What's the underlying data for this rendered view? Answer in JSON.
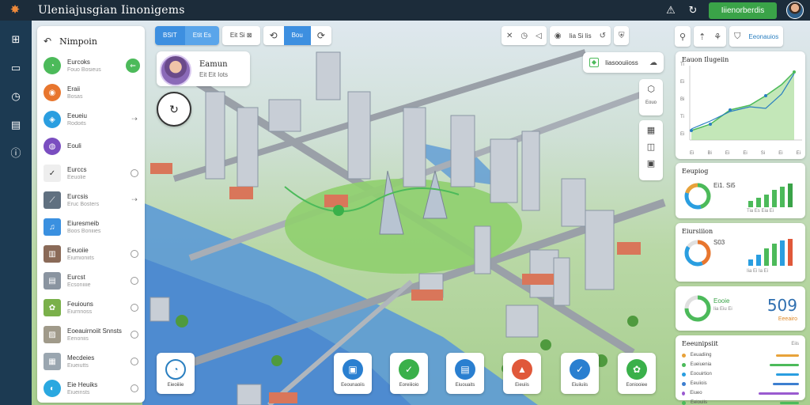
{
  "app": {
    "title": "Uleniajusgian Iinonigems"
  },
  "topbar": {
    "action_label": "Iiienorberdis"
  },
  "left_panel": {
    "title": "Nimpoin",
    "items": [
      {
        "name": "Eurcoks",
        "sub": "Fouo Bosieus",
        "color": "#4cba5a",
        "shape": "circle",
        "action": "green",
        "glyph": "◔"
      },
      {
        "name": "Eraii",
        "sub": "Bosas",
        "color": "#e8762e",
        "shape": "circle",
        "action": "none",
        "glyph": "◉"
      },
      {
        "name": "Eeueiu",
        "sub": "Rodoits",
        "color": "#2a9ee0",
        "shape": "circle",
        "action": "arrow",
        "glyph": "◈"
      },
      {
        "name": "Eouli",
        "sub": "",
        "color": "#7a4ec0",
        "shape": "circle",
        "action": "none",
        "glyph": "◍"
      },
      {
        "name": "Eurccs",
        "sub": "Eeuolie",
        "color": "#eeeeee",
        "shape": "square",
        "action": "ring",
        "glyph": "✓"
      },
      {
        "name": "Eurcsis",
        "sub": "Eruc Bosters",
        "color": "#607080",
        "shape": "square",
        "action": "arrow",
        "glyph": "⟋"
      },
      {
        "name": "Eiuresmeib",
        "sub": "Boos Boniiies",
        "color": "#3a90e0",
        "shape": "square",
        "action": "none",
        "glyph": "♫"
      },
      {
        "name": "Eeuoiie",
        "sub": "Eiumioniits",
        "color": "#8a6a58",
        "shape": "square",
        "action": "ring",
        "glyph": "▥"
      },
      {
        "name": "Eurcst",
        "sub": "Ecsoniiiie",
        "color": "#8a94a0",
        "shape": "square",
        "action": "ring",
        "glyph": "▤"
      },
      {
        "name": "Feuiouns",
        "sub": "Eiurnnoss",
        "color": "#7ab04a",
        "shape": "square",
        "action": "ring",
        "glyph": "✿"
      },
      {
        "name": "Eoeauirnoiit Snnsts",
        "sub": "Eenoniis",
        "color": "#a09a8a",
        "shape": "square",
        "action": "ring",
        "glyph": "▨"
      },
      {
        "name": "Mecdeies",
        "sub": "Eiueiutts",
        "color": "#9aa6b0",
        "shape": "square",
        "action": "ring",
        "glyph": "▦"
      },
      {
        "name": "Eie Heuiks",
        "sub": "Eiueinsts",
        "color": "#2aa8e0",
        "shape": "circle",
        "action": "ring",
        "glyph": "◐"
      }
    ]
  },
  "toolbar": {
    "btn1": "BSIT",
    "btn2": "Etit Es",
    "btn3": "Eit Si ⊠",
    "btn4": "Bou"
  },
  "map_tools": {
    "label": "Iia Si Iis"
  },
  "user_card": {
    "name": "Eamun",
    "sub": "Eit Eit Iots"
  },
  "clock": {
    "glyph": "↻"
  },
  "notify": {
    "label": "Iiasoouiioss"
  },
  "side_tools": {
    "label1": "Eouo"
  },
  "right_tools": {
    "label": "Eeonauios"
  },
  "widget_line": {
    "title": "Eauon Ilugeiin",
    "y_ticks": [
      "Ti",
      "Ei",
      "Bi",
      "Ti",
      "Ei"
    ],
    "x_ticks": [
      "Ei",
      "Bi",
      "Ei",
      "Ei",
      "Si",
      "Ei",
      "Ei"
    ]
  },
  "widget_bars1": {
    "title": "Eeupiog",
    "value": "Ei1. Si5",
    "sub": "Tia Es Eia Ei"
  },
  "widget_bars2": {
    "title": "Eiursiiion",
    "value": "S03",
    "sub": "Iia Ei Ia Ei"
  },
  "widget_kpi": {
    "label": "Eooie",
    "sub": "Iia Eiu Ei",
    "value": "509",
    "value_sub": "Eeeairo"
  },
  "widget_legend": {
    "title": "Eeeunipsiit",
    "tag": "Eiis",
    "rows": [
      {
        "label": "Eeuadiing",
        "color": "#e8a23a"
      },
      {
        "label": "Eueiuenia",
        "color": "#4cba5a"
      },
      {
        "label": "Eoouirtion",
        "color": "#2a9ee0"
      },
      {
        "label": "Eeuiiois",
        "color": "#3d7fd0"
      },
      {
        "label": "Eiueo",
        "color": "#9a5ad0"
      },
      {
        "label": "Eeiouiis",
        "color": "#4cba5a"
      }
    ]
  },
  "dock": [
    {
      "label": "Eieoiiiie",
      "color": "#ffffff",
      "glyph": "◔",
      "border": "#2a7fc0"
    },
    {
      "label": "Eeounaoiis",
      "color": "#2a7fd0",
      "glyph": "▣",
      "border": ""
    },
    {
      "label": "Eoreiiioio",
      "color": "#3ab04a",
      "glyph": "✓",
      "border": ""
    },
    {
      "label": "Eiuouaits",
      "color": "#2a7fd0",
      "glyph": "▤",
      "border": ""
    },
    {
      "label": "Eieuiis",
      "color": "#e0583a",
      "glyph": "▲",
      "border": ""
    },
    {
      "label": "Eiuiiuiis",
      "color": "#2a7fd0",
      "glyph": "✓",
      "border": ""
    },
    {
      "label": "Eoniooiee",
      "color": "#3ab04a",
      "glyph": "✿",
      "border": ""
    }
  ]
}
